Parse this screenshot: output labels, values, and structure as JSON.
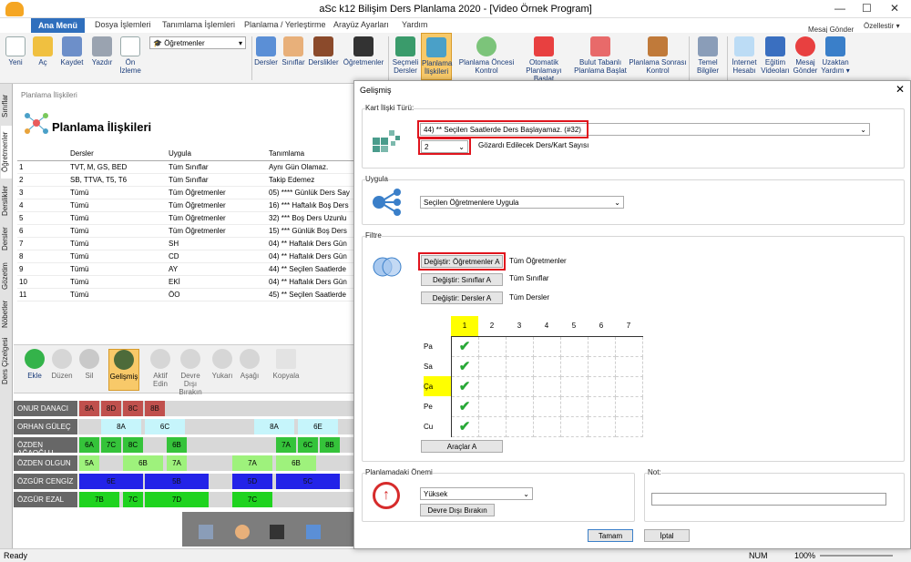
{
  "window": {
    "title": "aSc k12 Bilişim Ders Planlama 2020  - [Video Örnek Program]"
  },
  "menu": {
    "tabs": [
      "Ana Menü",
      "Dosya İşlemleri",
      "Tanımlama İşlemleri",
      "Planlama / Yerleştirme",
      "Arayüz Ayarları",
      "Yardım"
    ],
    "message": "Mesaj Gönder",
    "features": "Özellestir ▾"
  },
  "ribbon": {
    "new": "Yeni",
    "open": "Aç",
    "save": "Kaydet",
    "print": "Yazdır",
    "preview": "Ön İzleme",
    "view_select": "Öğretmenler",
    "lessons": "Dersler",
    "classes": "Sınıflar",
    "classrooms": "Derslikler",
    "teachers": "Öğretmenler",
    "selected_lessons": "Seçmeli Dersler",
    "planning_relations": "Planlama İlişkileri",
    "pre_check": "Planlama Öncesi Kontrol",
    "auto_start": "Otomatik Planlamayı Başlat",
    "cloud_start": "Bulut Tabanlı Planlama Başlat",
    "post_check": "Planlama Sonrası Kontrol",
    "basic_info": "Temel Bilgiler",
    "internet": "İnternet Hesabı",
    "tutorials": "Eğitim Videoları",
    "send_msg": "Mesaj Gönder",
    "remote": "Uzaktan Yardım ▾"
  },
  "sidetabs": [
    "Sınıflar",
    "Öğretmenler",
    "Derslikler",
    "Dersler",
    "Gözetim",
    "Nöbetler",
    "Ders Çizelgesi"
  ],
  "panel": {
    "breadcrumb": "Planlama İlişkileri",
    "title": "Planlama İlişkileri",
    "columns": [
      "",
      "Dersler",
      "Uygula",
      "Tanımlama"
    ],
    "rows": [
      [
        "1",
        "TVT, M, GS, BED",
        "Tüm Sınıflar",
        "Aynı Gün Olamaz."
      ],
      [
        "2",
        "SB, TTVA, T5, T6",
        "Tüm Sınıflar",
        "Takip Edemez"
      ],
      [
        "3",
        "Tümü",
        "Tüm Öğretmenler",
        "05) **** Günlük Ders Say"
      ],
      [
        "4",
        "Tümü",
        "Tüm Öğretmenler",
        "16) *** Haftalık Boş Ders"
      ],
      [
        "5",
        "Tümü",
        "Tüm Öğretmenler",
        "32) *** Boş Ders Uzunlu"
      ],
      [
        "6",
        "Tümü",
        "Tüm Öğretmenler",
        "15) *** Günlük Boş Ders"
      ],
      [
        "7",
        "Tümü",
        "SH",
        "04) ** Haftalık Ders Gün"
      ],
      [
        "8",
        "Tümü",
        "CD",
        "04) ** Haftalık Ders Gün"
      ],
      [
        "9",
        "Tümü",
        "AY",
        "44) ** Seçilen Saatlerde"
      ],
      [
        "10",
        "Tümü",
        "EKİ",
        "04) ** Haftalık Ders Gün"
      ],
      [
        "11",
        "Tümü",
        "ÖO",
        "45) ** Seçilen Saatlerde"
      ]
    ]
  },
  "tools": {
    "add": "Ekle",
    "edit": "Düzen",
    "delete": "Sil",
    "advanced": "Gelişmiş",
    "enable": "Aktif Edin",
    "disable": "Devre Dışı Bırakın",
    "up": "Yukarı",
    "down": "Aşağı",
    "copy": "Kopyala"
  },
  "schedule": [
    {
      "name": "ONUR DANACI",
      "cells": [
        {
          "t": "8A",
          "c": "#c0504d"
        },
        {
          "t": "8D",
          "c": "#c0504d"
        },
        {
          "t": "8C",
          "c": "#c0504d"
        },
        {
          "t": "8B",
          "c": "#c0504d"
        }
      ]
    },
    {
      "name": "ORHAN GÜLEÇ",
      "cells": [
        {
          "t": "8A",
          "c": "#c6f5fb"
        },
        {
          "t": "6C",
          "c": "#c6f5fb"
        },
        {
          "t": "8A",
          "c": "#c6f5fb"
        },
        {
          "t": "6E",
          "c": "#c6f5fb"
        }
      ]
    },
    {
      "name": "ÖZDEN AĞAOĞLU",
      "cells": [
        {
          "t": "6A",
          "c": "#35c33a"
        },
        {
          "t": "7C",
          "c": "#35c33a"
        },
        {
          "t": "8C",
          "c": "#35c33a"
        },
        {
          "t": "6B",
          "c": "#35c33a"
        },
        {
          "t": "7A",
          "c": "#35c33a"
        },
        {
          "t": "6C",
          "c": "#35c33a"
        },
        {
          "t": "8B",
          "c": "#35c33a"
        }
      ]
    },
    {
      "name": "ÖZDEN OLGUN",
      "cells": [
        {
          "t": "5A",
          "c": "#9ef27c"
        },
        {
          "t": "6B",
          "c": "#9ef27c"
        },
        {
          "t": "7A",
          "c": "#9ef27c"
        },
        {
          "t": "7A",
          "c": "#9ef27c"
        },
        {
          "t": "6B",
          "c": "#9ef27c"
        }
      ]
    },
    {
      "name": "ÖZGÜR CENGİZ",
      "cells": [
        {
          "t": "6E",
          "c": "#2323e8"
        },
        {
          "t": "5B",
          "c": "#2323e8"
        },
        {
          "t": "5D",
          "c": "#2323e8"
        },
        {
          "t": "5C",
          "c": "#2323e8"
        }
      ]
    },
    {
      "name": "ÖZGÜR EZAL",
      "cells": [
        {
          "t": "7B",
          "c": "#1fd31f"
        },
        {
          "t": "7C",
          "c": "#1fd31f"
        },
        {
          "t": "7D",
          "c": "#1fd31f"
        },
        {
          "t": "7C",
          "c": "#1fd31f"
        }
      ]
    }
  ],
  "status": {
    "left": "Ready",
    "num": "NUM",
    "zoom": "100%"
  },
  "dialog": {
    "title": "Gelişmiş",
    "card_type_label": "Kart İlişki Türü:",
    "card_type": "44) ** Seçilen Saatlerde Ders Başlayamaz. (#32)",
    "ignore_value": "2",
    "ignore_label": "Gözardı Edilecek Ders/Kart Sayısı",
    "apply_label": "Uygula",
    "apply_value": "Seçilen Öğretmenlere Uygula",
    "filter_label": "Filtre",
    "change_teachers": "Değiştir: Öğretmenler A",
    "teachers_value": "Tüm Öğretmenler",
    "change_classes": "Değiştir: Sınıflar A",
    "classes_value": "Tüm Sınıflar",
    "change_lessons": "Değiştir: Dersler A",
    "lessons_value": "Tüm Dersler",
    "periods": [
      "1",
      "2",
      "3",
      "4",
      "5",
      "6",
      "7"
    ],
    "days": [
      "Pa",
      "Sa",
      "Ça",
      "Pe",
      "Cu"
    ],
    "tools_btn": "Araçlar A",
    "importance_label": "Planlamadaki Önemi",
    "importance_value": "Yüksek",
    "disable_btn": "Devre Dışı Bırakın",
    "note_label": "Not:",
    "ok": "Tamam",
    "cancel": "İptal"
  }
}
